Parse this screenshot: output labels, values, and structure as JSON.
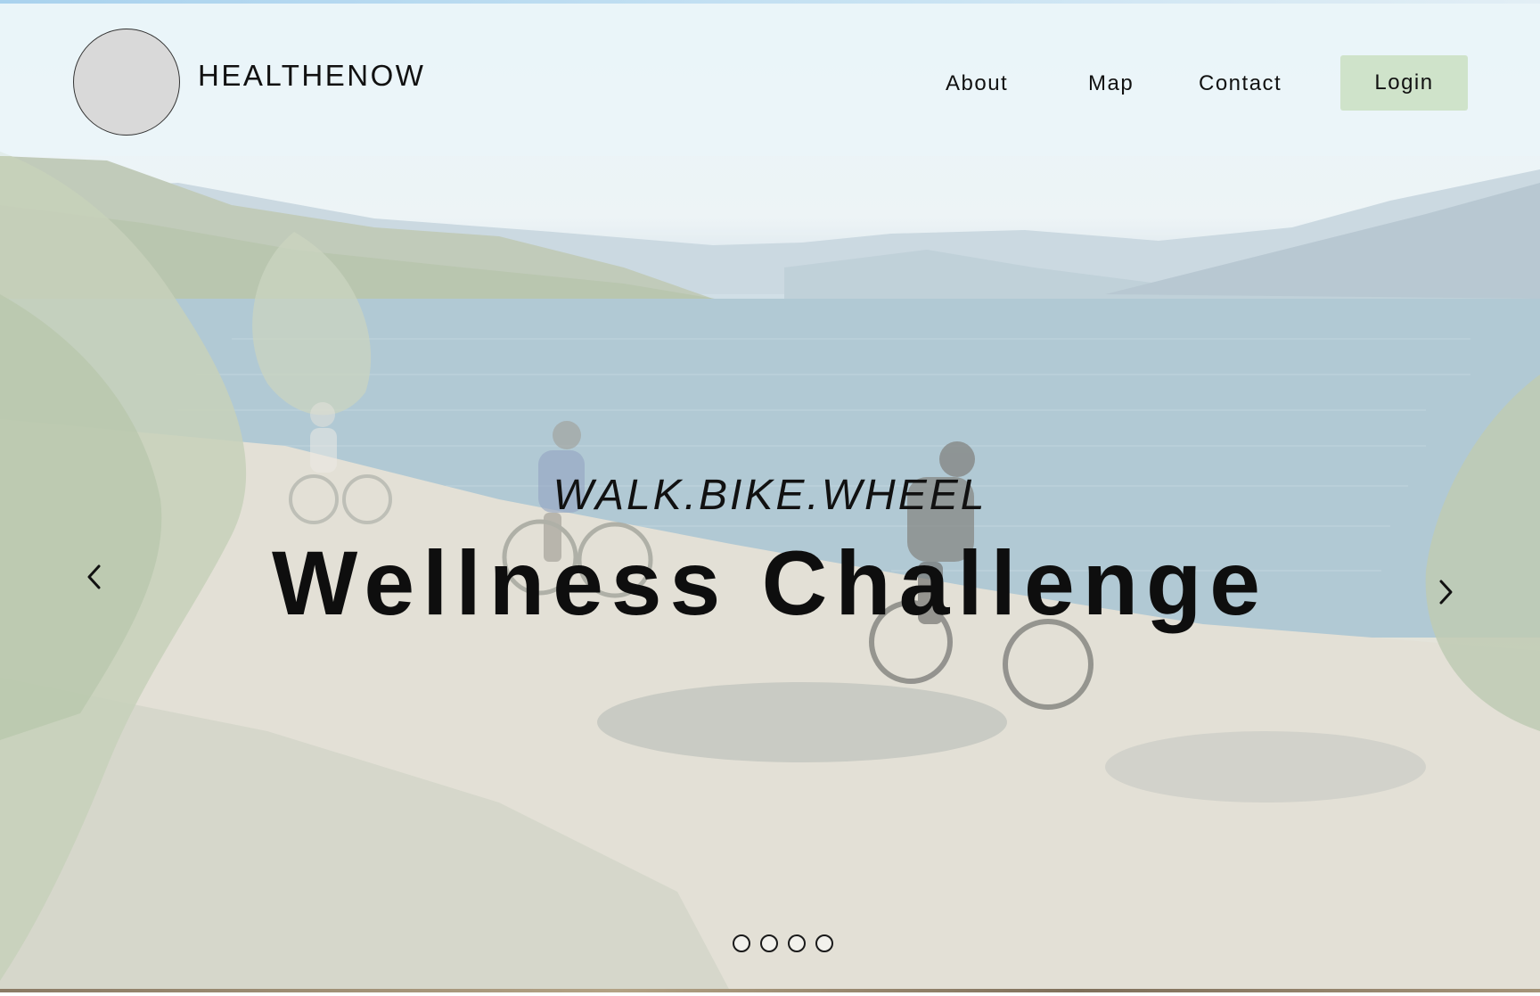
{
  "header": {
    "brand": "HEALTHENOW",
    "nav": {
      "about": "About",
      "map": "Map",
      "contact": "Contact",
      "login": "Login"
    }
  },
  "hero": {
    "tagline": "WALK.BIKE.WHEEL",
    "headline": "Wellness Challenge",
    "image_alt": "Cyclists riding along a lakeside trail",
    "slide_count": 4
  },
  "colors": {
    "login_button_bg": "#cfe3ca",
    "header_overlay": "#eaf5fa",
    "text": "#111111"
  },
  "icons": {
    "prev": "chevron-left-icon",
    "next": "chevron-right-icon",
    "logo": "logo-placeholder-circle"
  }
}
